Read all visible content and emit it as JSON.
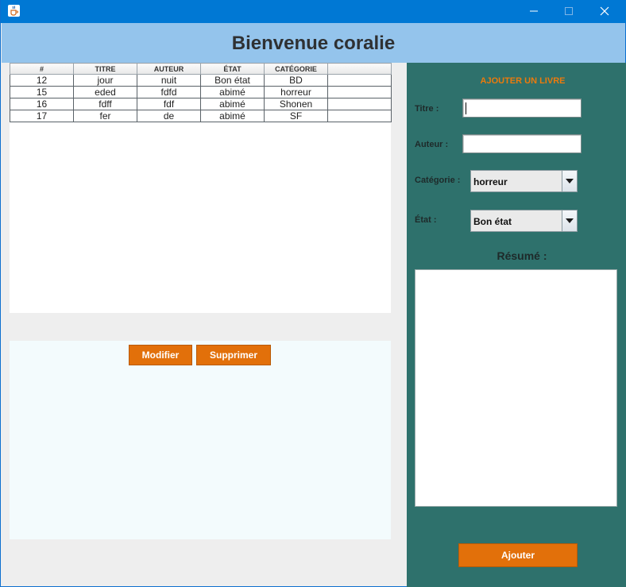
{
  "window": {
    "app_icon": "java-cup-icon",
    "controls": [
      "minimize-icon",
      "maximize-icon",
      "close-icon"
    ]
  },
  "header": {
    "title": "Bienvenue coralie"
  },
  "table": {
    "columns": [
      "#",
      "TITRE",
      "AUTEUR",
      "ÉTAT",
      "CATÉGORIE",
      ""
    ],
    "rows": [
      [
        "12",
        "jour",
        "nuit",
        "Bon état",
        "BD",
        ""
      ],
      [
        "15",
        "eded",
        "fdfd",
        "abimé",
        "horreur",
        ""
      ],
      [
        "16",
        "fdff",
        "fdf",
        "abimé",
        "Shonen",
        ""
      ],
      [
        "17",
        "fer",
        "de",
        "abimé",
        "SF",
        ""
      ]
    ]
  },
  "actions": {
    "modifier": "Modifier",
    "supprimer": "Supprimer"
  },
  "form": {
    "title": "AJOUTER UN LIVRE",
    "titre_label": "Titre :",
    "titre_value": "",
    "auteur_label": "Auteur :",
    "auteur_value": "",
    "categorie_label": "Catégorie :",
    "categorie_value": "horreur",
    "etat_label": "État :",
    "etat_value": "Bon état",
    "resume_label": "Résumé :",
    "resume_value": "",
    "submit_label": "Ajouter"
  },
  "colors": {
    "titlebar": "#0078d4",
    "header": "#94c4ec",
    "side_panel": "#2e716c",
    "accent_orange": "#e2700a",
    "form_title": "#ec7a0c"
  }
}
